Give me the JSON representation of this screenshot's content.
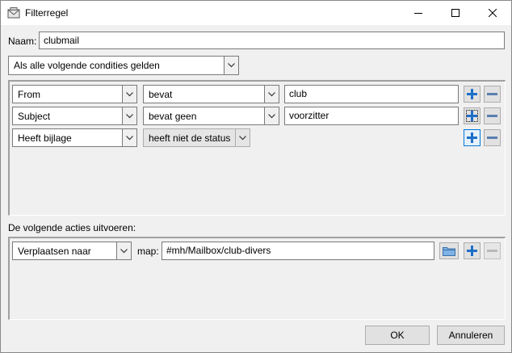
{
  "window": {
    "title": "Filterregel",
    "icon": "mail-filter-icon"
  },
  "name_field": {
    "label": "Naam:",
    "value": "clubmail"
  },
  "match_mode": {
    "selected": "Als alle volgende condities gelden"
  },
  "conditions": [
    {
      "field": "From",
      "operator": "bevat",
      "value": "club"
    },
    {
      "field": "Subject",
      "operator": "bevat geen",
      "value": "voorzitter"
    },
    {
      "field": "Heeft bijlage",
      "operator": "heeft niet de status"
    }
  ],
  "actions_header": "De volgende acties uitvoeren:",
  "actions": [
    {
      "action": "Verplaatsen naar",
      "folder_label": "map:",
      "folder_value": "#mh/Mailbox/club-divers"
    }
  ],
  "buttons": {
    "ok": "OK",
    "cancel": "Annuleren"
  },
  "colors": {
    "plus_icon": "#1e6fc8",
    "minus_icon": "#5a7fb0",
    "focus_border": "#0078d7"
  }
}
